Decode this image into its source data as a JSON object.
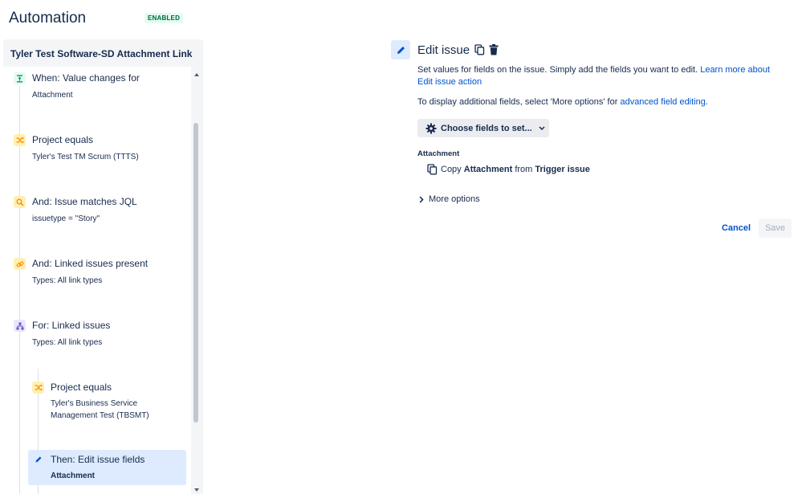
{
  "header": {
    "title": "Automation",
    "status_badge": "ENABLED"
  },
  "rule": {
    "name": "Tyler Test Software-SD Attachment Link",
    "steps": [
      {
        "title": "When: Value changes for",
        "subtitle": "Attachment",
        "icon": "trigger-icon"
      },
      {
        "title": "Project equals",
        "subtitle": "Tyler's Test TM Scrum (TTTS)",
        "icon": "shuffle-icon"
      },
      {
        "title": "And: Issue matches JQL",
        "subtitle": "issuetype = \"Story\"",
        "icon": "search-icon"
      },
      {
        "title": "And: Linked issues present",
        "subtitle": "Types: All link types",
        "icon": "link-icon"
      },
      {
        "title": "For: Linked issues",
        "subtitle": "Types: All link types",
        "icon": "hierarchy-icon"
      },
      {
        "title": "Project equals",
        "subtitle_line1": "Tyler's Business Service",
        "subtitle_line2": "Management Test (TBSMT)",
        "icon": "shuffle-icon"
      },
      {
        "title": "Then: Edit issue fields",
        "subtitle": "Attachment",
        "icon": "pencil-icon"
      }
    ]
  },
  "detail": {
    "title": "Edit issue",
    "description": "Set values for fields on the issue. Simply add the fields you want to edit.",
    "learn_more_link": "Learn more about Edit issue action",
    "additional_prefix": "To display additional fields, select 'More options' for",
    "advanced_link": "advanced field editing",
    "additional_suffix": ".",
    "choose_fields_label": "Choose fields to set...",
    "field_label": "Attachment",
    "copy_prefix": "Copy",
    "copy_field": "Attachment",
    "copy_middle": "from",
    "copy_source": "Trigger issue",
    "more_options": "More options",
    "cancel_label": "Cancel",
    "save_label": "Save"
  },
  "colors": {
    "accent": "#0052cc",
    "enabled_bg": "#e3fcef",
    "enabled_text": "#006644",
    "selected_bg": "#deebff"
  }
}
